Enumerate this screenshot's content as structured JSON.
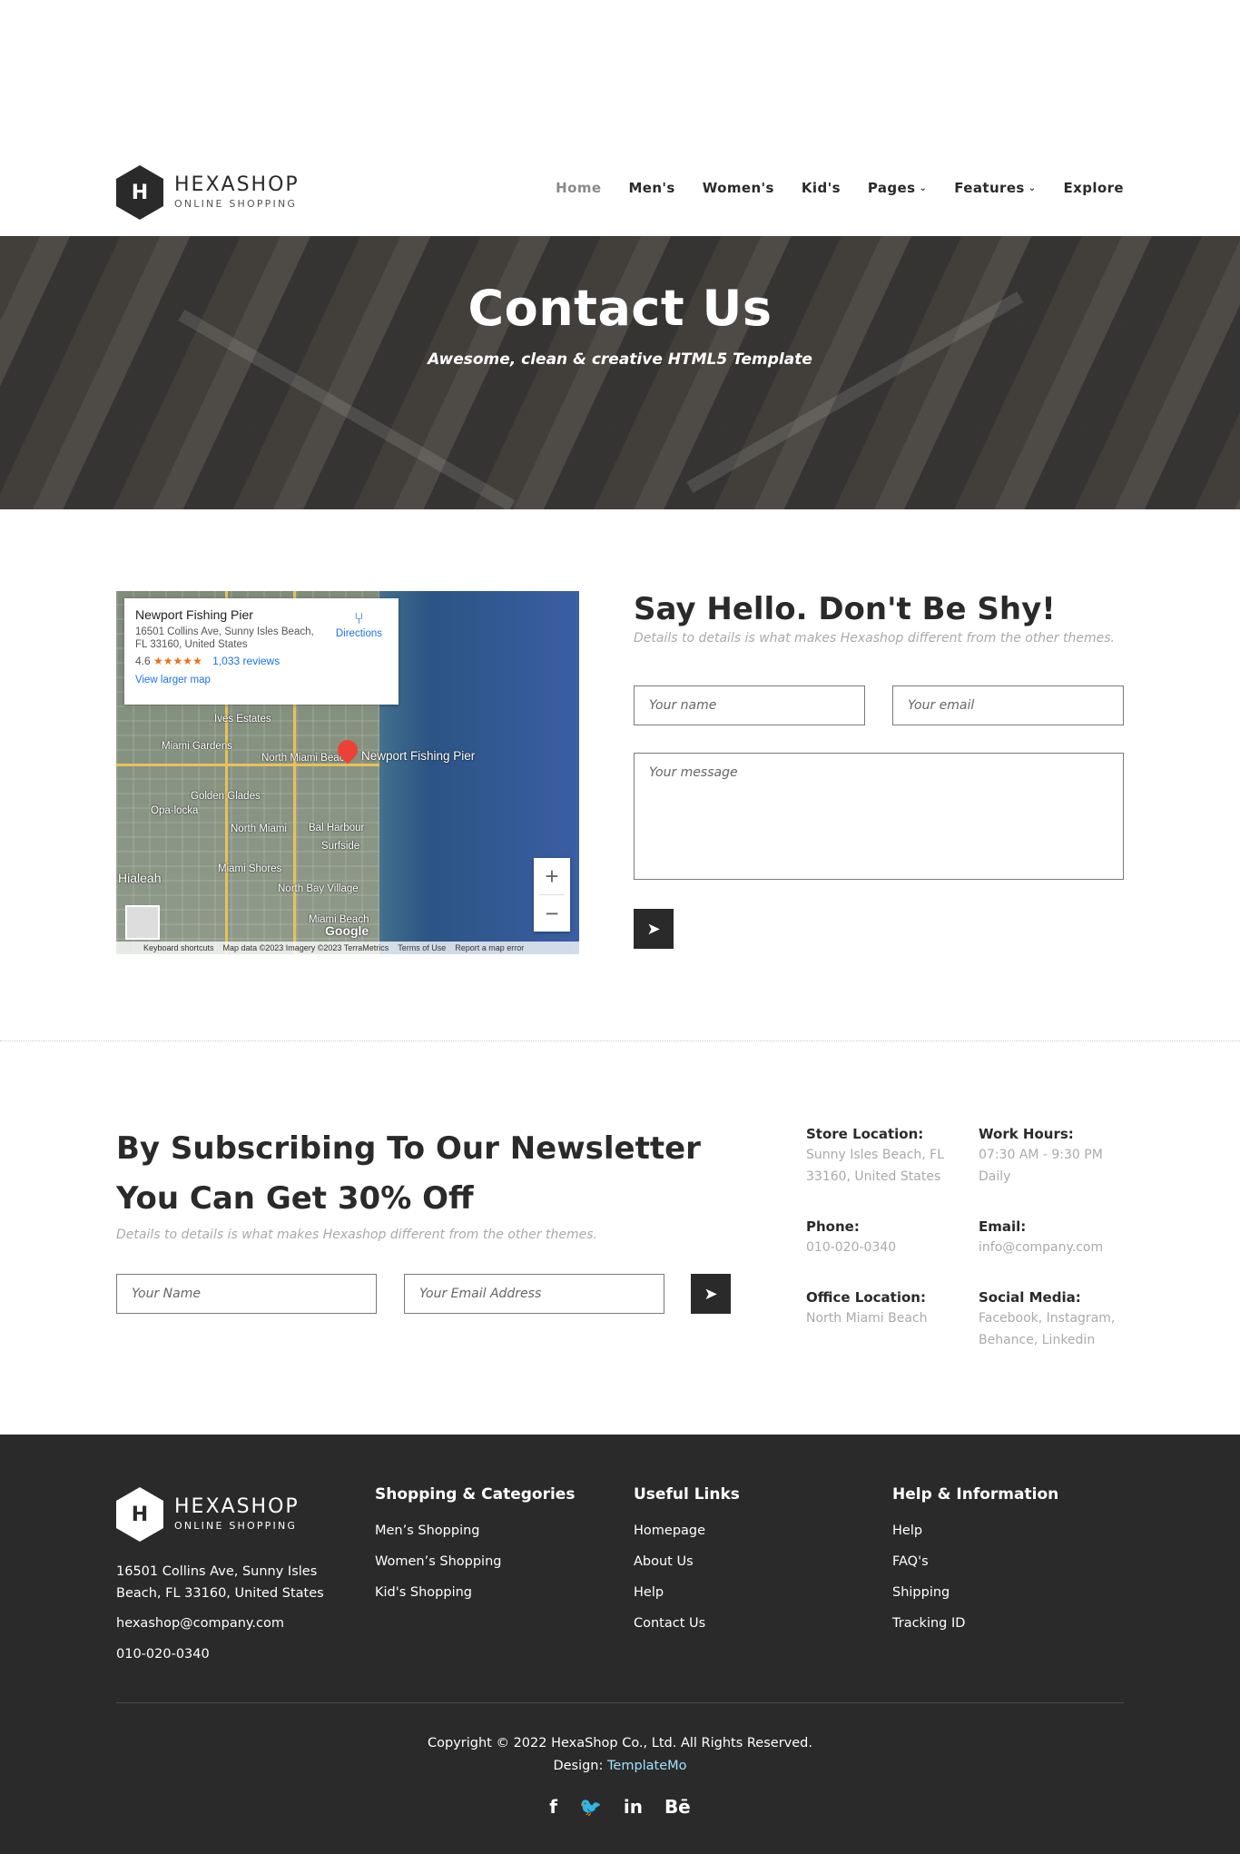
{
  "brand": {
    "name": "HEXASHOP",
    "tagline": "ONLINE SHOPPING",
    "logo_letter": "H"
  },
  "nav": {
    "items": [
      {
        "label": "Home",
        "active": true
      },
      {
        "label": "Men's"
      },
      {
        "label": "Women's"
      },
      {
        "label": "Kid's"
      },
      {
        "label": "Pages",
        "dropdown": true
      },
      {
        "label": "Features",
        "dropdown": true
      },
      {
        "label": "Explore"
      }
    ]
  },
  "hero": {
    "title": "Contact Us",
    "subtitle": "Awesome, clean & creative HTML5 Template"
  },
  "map": {
    "place": "Newport Fishing Pier",
    "address": "16501 Collins Ave, Sunny Isles Beach, FL 33160, United States",
    "rating": "4.6",
    "stars": "★★★★★",
    "reviews": "1,033 reviews",
    "directions": "Directions",
    "larger_map": "View larger map",
    "pin_label": "Newport Fishing Pier",
    "places": [
      "Ives Estates",
      "Miami Gardens",
      "North Miami Beach",
      "Golden Glades",
      "Opa-locka",
      "North Miami",
      "Bal Harbour",
      "Surfside",
      "Miami Shores",
      "Hialeah",
      "North Bay Village",
      "Miami Beach"
    ],
    "zoom_in": "+",
    "zoom_out": "−",
    "google": "Google",
    "footer": [
      "Keyboard shortcuts",
      "Map data ©2023 Imagery ©2023 TerraMetrics",
      "Terms of Use",
      "Report a map error"
    ]
  },
  "contact_form": {
    "title": "Say Hello. Don't Be Shy!",
    "subtitle": "Details to details is what makes Hexashop different from the other themes.",
    "name_placeholder": "Your name",
    "email_placeholder": "Your email",
    "message_placeholder": "Your message",
    "send_icon": "paper-plane-icon"
  },
  "newsletter": {
    "title": "By Subscribing To Our Newsletter You Can Get 30% Off",
    "subtitle": "Details to details is what makes Hexashop different from the other themes.",
    "name_placeholder": "Your Name",
    "email_placeholder": "Your Email Address"
  },
  "info": {
    "store_location": {
      "label": "Store Location:",
      "value": "Sunny Isles Beach, FL 33160, United States"
    },
    "work_hours": {
      "label": "Work Hours:",
      "value": "07:30 AM - 9:30 PM Daily"
    },
    "phone": {
      "label": "Phone:",
      "value": "010-020-0340"
    },
    "email": {
      "label": "Email:",
      "value": "info@company.com"
    },
    "office_location": {
      "label": "Office Location:",
      "value": "North Miami Beach"
    },
    "social_media": {
      "label": "Social Media:",
      "value": "Facebook, Instagram, Behance, Linkedin"
    }
  },
  "footer": {
    "address": "16501 Collins Ave, Sunny Isles Beach, FL 33160, United States",
    "email": "hexashop@company.com",
    "phone": "010-020-0340",
    "columns": [
      {
        "title": "Shopping & Categories",
        "links": [
          "Men’s Shopping",
          "Women’s Shopping",
          "Kid's Shopping"
        ]
      },
      {
        "title": "Useful Links",
        "links": [
          "Homepage",
          "About Us",
          "Help",
          "Contact Us"
        ]
      },
      {
        "title": "Help & Information",
        "links": [
          "Help",
          "FAQ's",
          "Shipping",
          "Tracking ID"
        ]
      }
    ],
    "copyright": "Copyright © 2022 HexaShop Co., Ltd. All Rights Reserved.",
    "design_label": "Design:",
    "design_link": "TemplateMo",
    "social": [
      "f",
      "🐦",
      "in",
      "Bē"
    ]
  },
  "colors": {
    "dark": "#2a2a2a",
    "muted": "#aaaaaa",
    "link": "#a0e0ff"
  }
}
